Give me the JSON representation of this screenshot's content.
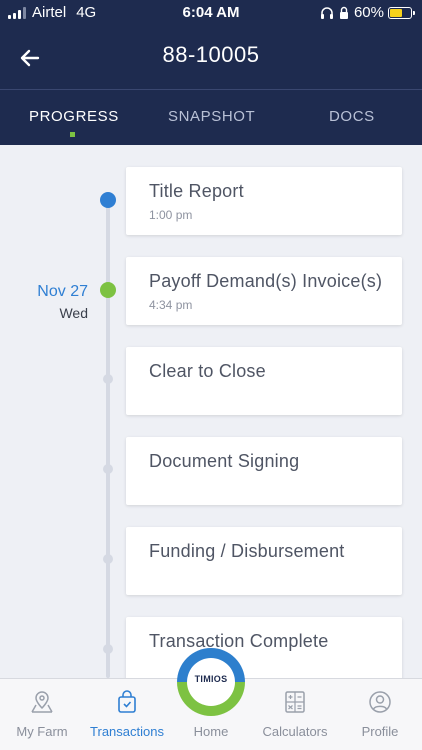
{
  "status_bar": {
    "carrier": "Airtel",
    "network": "4G",
    "time": "6:04 AM",
    "battery": "60%",
    "battery_level": 0.6
  },
  "header": {
    "title": "88-10005"
  },
  "tabs": [
    {
      "label": "PROGRESS",
      "active": true
    },
    {
      "label": "SNAPSHOT",
      "active": false
    },
    {
      "label": "DOCS",
      "active": false
    }
  ],
  "timeline": {
    "date": {
      "day": "Nov 27",
      "weekday": "Wed"
    },
    "items": [
      {
        "title": "Title Report",
        "time": "1:00 pm",
        "status": "active"
      },
      {
        "title": "Payoff Demand(s) Invoice(s)",
        "time": "4:34 pm",
        "status": "complete"
      },
      {
        "title": "Clear to Close",
        "time": "",
        "status": "pending"
      },
      {
        "title": "Document Signing",
        "time": "",
        "status": "pending"
      },
      {
        "title": "Funding / Disbursement",
        "time": "",
        "status": "pending"
      },
      {
        "title": "Transaction Complete",
        "time": "",
        "status": "pending"
      }
    ]
  },
  "bottom_nav": {
    "items": [
      {
        "label": "My Farm",
        "icon": "map-pin-icon"
      },
      {
        "label": "Transactions",
        "icon": "shopping-bag-icon",
        "active": true
      },
      {
        "label": "Home",
        "icon": "timios-logo"
      },
      {
        "label": "Calculators",
        "icon": "calculator-icon"
      },
      {
        "label": "Profile",
        "icon": "profile-icon"
      }
    ],
    "logo_text": "TIMIOS"
  },
  "colors": {
    "header_bg": "#1e2b4f",
    "accent_blue": "#2f7fd3",
    "accent_green": "#7dc242",
    "timeline_gray": "#d5d9e3"
  }
}
